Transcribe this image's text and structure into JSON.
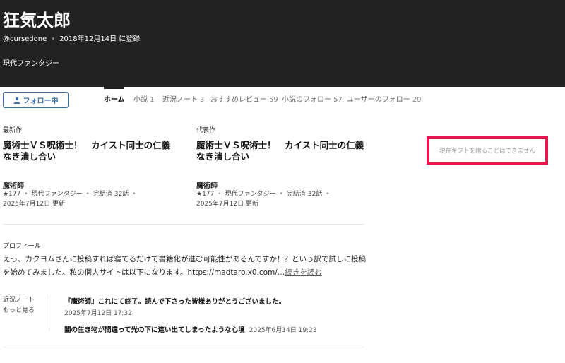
{
  "user": {
    "name": "狂気太郎",
    "handle": "@cursedone",
    "joined": "2018年12月14日 に登録",
    "genre": "現代ファンタジー"
  },
  "follow_button": {
    "label": "フォロー中"
  },
  "tabs": [
    {
      "label": "ホーム",
      "count": ""
    },
    {
      "label": "小説",
      "count": "1"
    },
    {
      "label": "近況ノート",
      "count": "3"
    },
    {
      "label": "おすすめレビュー",
      "count": "59"
    },
    {
      "label": "小説のフォロー",
      "count": "57"
    },
    {
      "label": "ユーザーのフォロー",
      "count": "20"
    }
  ],
  "latest_work": {
    "label": "最新作",
    "title": "魔術士ＶＳ呪術士！　カイスト同士の仁義なき潰し合い",
    "author": "魔術師",
    "stars": "★177",
    "genre": "現代ファンタジー",
    "status": "完結済 32話",
    "updated": "2025年7月12日 更新"
  },
  "featured_work": {
    "label": "代表作",
    "title": "魔術士ＶＳ呪術士！　カイスト同士の仁義なき潰し合い",
    "author": "魔術師",
    "stars": "★177",
    "genre": "現代ファンタジー",
    "status": "完結済 32話",
    "updated": "2025年7月12日 更新"
  },
  "gift": {
    "message": "現在ギフトを贈ることはできません"
  },
  "profile": {
    "label": "プロフィール",
    "text": "えっ、カクヨムさんに投稿すれば寝てるだけで書籍化が進む可能性があるんですか！？という訳で試しに投稿を始めてみました。私の個人サイトは以下になります。https://madtaro.x0.com/",
    "ellipsis": "…",
    "more": "続きを読む"
  },
  "notes": {
    "label": "近況ノート",
    "more": "もっと見る",
    "items": [
      {
        "title": "『魔術師』これにて終了。読んで下さった皆様ありがとうございました。",
        "date": "2025年7月12日 17:32"
      },
      {
        "title": "闇の生き物が間違って光の下に這い出てしまったような心境",
        "date": "2025年6月14日 19:23"
      }
    ]
  },
  "colors": {
    "header_bg": "#222222",
    "accent_blue": "#3b6fa8",
    "highlight_red": "#e8174e"
  },
  "icons": {
    "follow": "person-icon"
  }
}
